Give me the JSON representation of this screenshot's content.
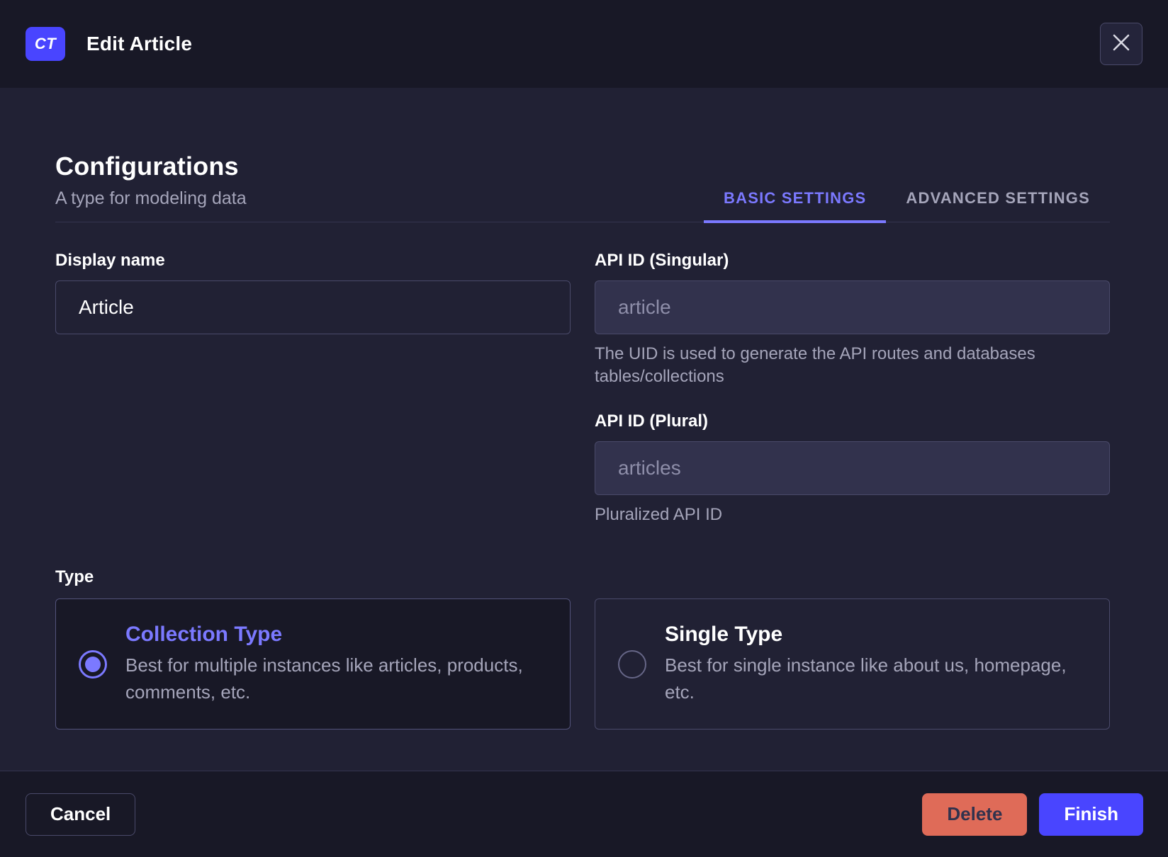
{
  "header": {
    "badge": "CT",
    "title": "Edit Article"
  },
  "content": {
    "heading": "Configurations",
    "subheading": "A type for modeling data",
    "tabs": [
      {
        "label": "BASIC SETTINGS"
      },
      {
        "label": "ADVANCED SETTINGS"
      }
    ],
    "fields": {
      "display_name": {
        "label": "Display name",
        "value": "Article"
      },
      "api_id_singular": {
        "label": "API ID (Singular)",
        "value": "article",
        "helper": "The UID is used to generate the API routes and databases tables/collections"
      },
      "api_id_plural": {
        "label": "API ID (Plural)",
        "value": "articles",
        "helper": "Pluralized API ID"
      }
    },
    "type_section": {
      "label": "Type",
      "options": [
        {
          "title": "Collection Type",
          "description": "Best for multiple instances like articles, products,\ncomments, etc.",
          "selected": true
        },
        {
          "title": "Single Type",
          "description": "Best for single instance like about us, homepage,\netc.",
          "selected": false
        }
      ]
    }
  },
  "footer": {
    "cancel_label": "Cancel",
    "delete_label": "Delete",
    "finish_label": "Finish"
  },
  "colors": {
    "accent": "#4945ff",
    "accent_light": "#7b79ff",
    "danger": "#df6b58",
    "surface": "#212134",
    "surface_dark": "#181826",
    "border": "#4a4a6a",
    "text_muted": "#a5a5ba"
  }
}
